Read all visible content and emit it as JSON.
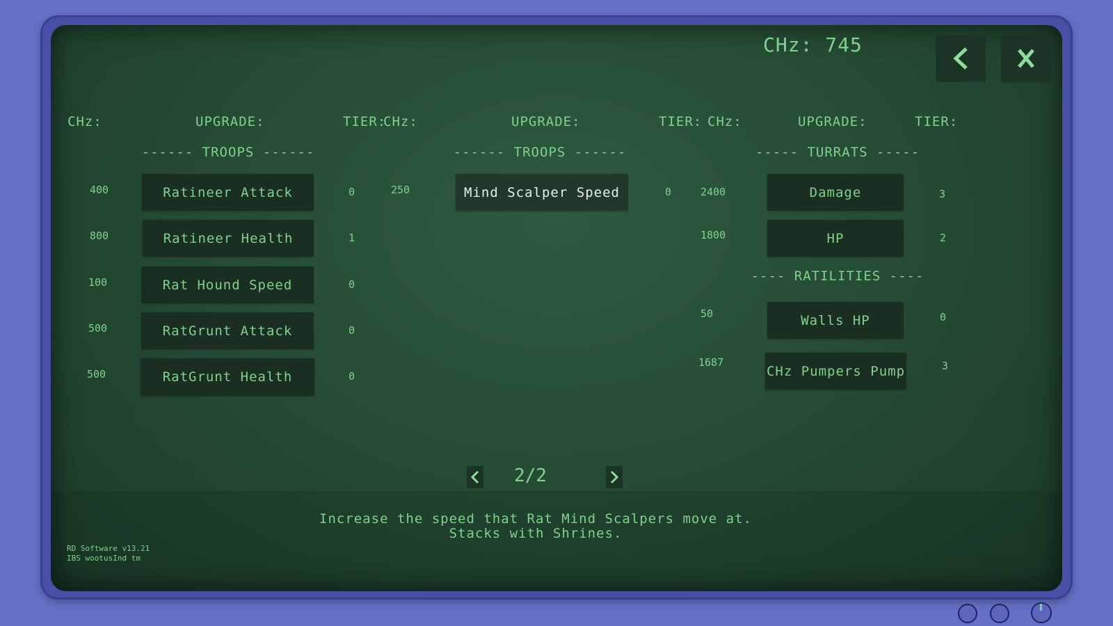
{
  "currency": {
    "label": "CHz:",
    "value": "745"
  },
  "top_buttons": {
    "back_icon": "chevron-left-icon",
    "close_icon": "close-x-icon"
  },
  "columns": [
    {
      "cost_header": "CHz:",
      "upgrade_header": "UPGRADE:",
      "tier_header": "TIER:"
    },
    {
      "cost_header": "CHz:",
      "upgrade_header": "UPGRADE:",
      "tier_header": "TIER:"
    },
    {
      "cost_header": "CHz:",
      "upgrade_header": "UPGRADE:",
      "tier_header": "TIER:"
    }
  ],
  "col1": {
    "section": "------ TROOPS ------",
    "items": [
      {
        "cost": "400",
        "label": "Ratineer Attack",
        "tier": "0"
      },
      {
        "cost": "800",
        "label": "Ratineer Health",
        "tier": "1"
      },
      {
        "cost": "100",
        "label": "Rat Hound Speed",
        "tier": "0"
      },
      {
        "cost": "500",
        "label": "RatGrunt Attack",
        "tier": "0"
      },
      {
        "cost": "500",
        "label": "RatGrunt Health",
        "tier": "0"
      }
    ]
  },
  "col2": {
    "section": "------ TROOPS ------",
    "items": [
      {
        "cost": "250",
        "label": "Mind Scalper Speed",
        "tier": "0"
      }
    ]
  },
  "col3": {
    "section": "----- TURRATS -----",
    "items": [
      {
        "cost": "2400",
        "label": "Damage",
        "tier": "3"
      },
      {
        "cost": "1800",
        "label": "HP",
        "tier": "2"
      }
    ],
    "section2": "---- RATILITIES ----",
    "items2": [
      {
        "cost": "50",
        "label": "Walls HP",
        "tier": "0"
      },
      {
        "cost": "1687",
        "label": "CHz Pumpers Pump",
        "tier": "3"
      }
    ]
  },
  "pager": {
    "text": "2/2"
  },
  "description": {
    "line1": "Increase the speed that Rat Mind Scalpers move at.",
    "line2": "Stacks with Shrines."
  },
  "version": {
    "line1": "RD Software v13.21",
    "line2": "IBS wootusInd tm"
  }
}
